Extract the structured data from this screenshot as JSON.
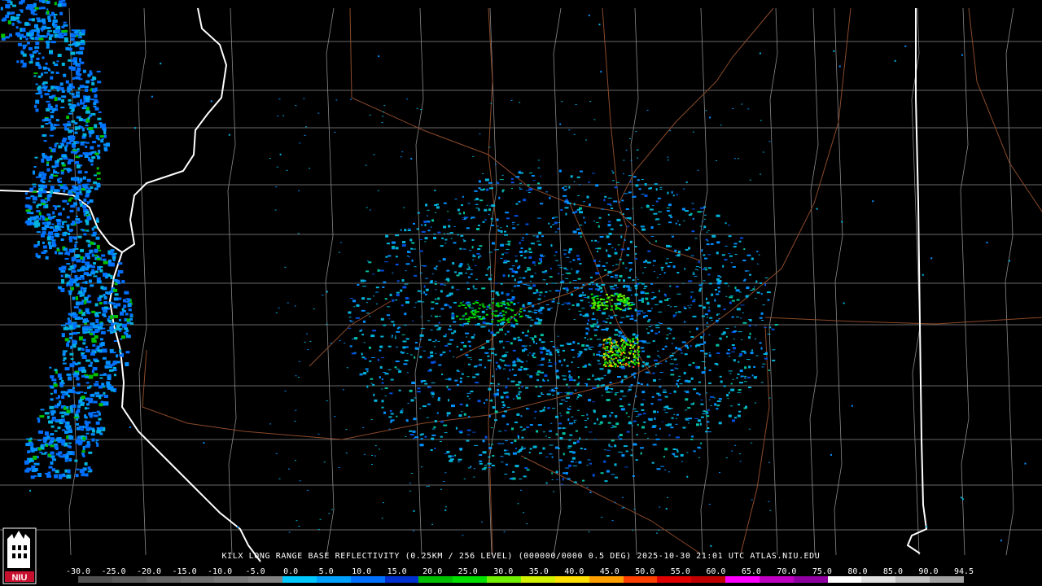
{
  "caption": "KILX LONG RANGE BASE REFLECTIVITY (0.25KM / 256 LEVEL) (000000/0000 0.5 DEG) 2025-10-30 21:01 UTC  ATLAS.NIU.EDU",
  "logo": {
    "text": "NIU",
    "color": "#c8102e"
  },
  "color_scale": {
    "labels": [
      "-30.0",
      "-25.0",
      "-20.0",
      "-15.0",
      "-10.0",
      "-5.0",
      "0.0",
      "5.0",
      "10.0",
      "15.0",
      "20.0",
      "25.0",
      "30.0",
      "35.0",
      "40.0",
      "45.0",
      "50.0",
      "55.0",
      "60.0",
      "65.0",
      "70.0",
      "75.0",
      "80.0",
      "85.0",
      "90.0",
      "94.5"
    ],
    "colors": [
      "#505050",
      "#5a5a5a",
      "#646464",
      "#6e6e6e",
      "#787878",
      "#828282",
      "#00c8ff",
      "#00a0ff",
      "#0070ff",
      "#0030d0",
      "#00c000",
      "#00e000",
      "#70f000",
      "#d0f000",
      "#ffe000",
      "#ffa000",
      "#ff4000",
      "#e00000",
      "#c00000",
      "#ff00ff",
      "#c000c0",
      "#9000a0",
      "#ffffff",
      "#e0e0e0",
      "#c0c0c0",
      "#a0a0a0"
    ]
  },
  "map_colors": {
    "background": "#000000",
    "county": "#8a8a8a",
    "state": "#ffffff",
    "road": "#8b4a2a"
  }
}
